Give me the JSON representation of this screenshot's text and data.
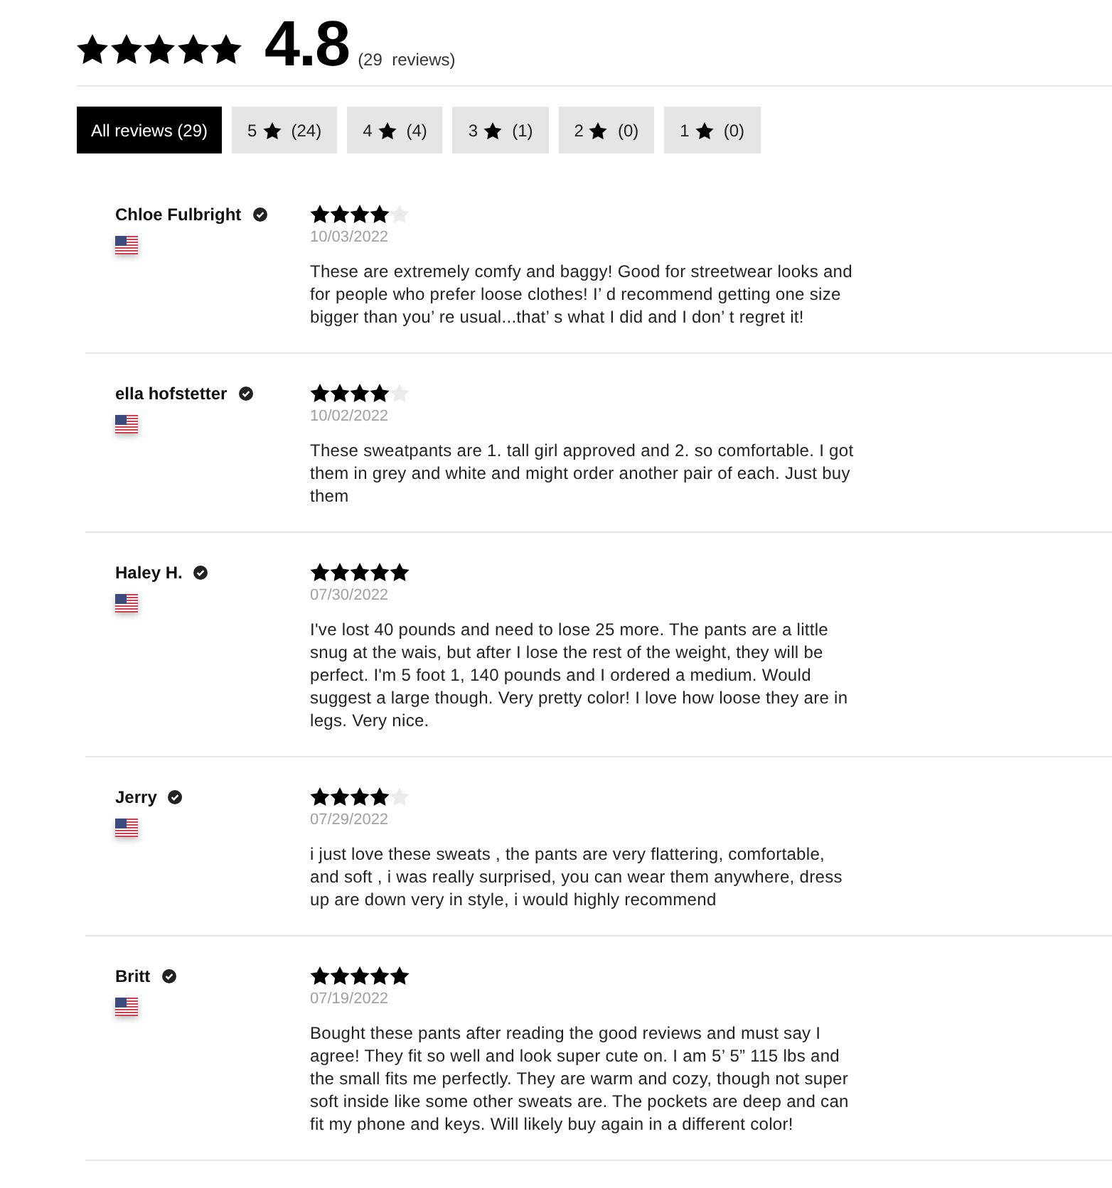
{
  "summary": {
    "stars": 5,
    "rating": "4.8",
    "count": "(29  reviews)"
  },
  "filters": [
    {
      "kind": "all",
      "label": "All reviews (29)",
      "selected": true
    },
    {
      "kind": "rating",
      "label": "5",
      "count": "(24)",
      "selected": false
    },
    {
      "kind": "rating",
      "label": "4",
      "count": "(4)",
      "selected": false
    },
    {
      "kind": "rating",
      "label": "3",
      "count": "(1)",
      "selected": false
    },
    {
      "kind": "rating",
      "label": "2",
      "count": "(0)",
      "selected": false
    },
    {
      "kind": "rating",
      "label": "1",
      "count": "(0)",
      "selected": false
    }
  ],
  "reviews": [
    {
      "name": "Chloe Fulbright",
      "verified": true,
      "stars": 4,
      "date": "10/03/2022",
      "text": "These are extremely comfy and baggy! Good for streetwear looks and for people who prefer loose clothes! I’ d recommend getting one size bigger than you’ re usual...that’ s what I did and I don’ t regret it!"
    },
    {
      "name": "ella hofstetter",
      "verified": true,
      "stars": 4,
      "date": "10/02/2022",
      "text": "These sweatpants are 1. tall girl approved and 2. so comfortable. I got them in grey and white and might order another pair of each. Just buy them"
    },
    {
      "name": "Haley H.",
      "verified": true,
      "stars": 5,
      "date": "07/30/2022",
      "text": "I've lost 40 pounds and need to lose 25 more. The pants are a little snug at the wais, but after I lose the rest of the weight, they will be perfect. I'm 5 foot 1, 140 pounds and I ordered a medium. Would suggest a large though. Very pretty color! I love how loose they are in legs. Very nice."
    },
    {
      "name": "Jerry",
      "verified": true,
      "stars": 4,
      "date": "07/29/2022",
      "text": "i just love these sweats , the pants are very flattering, comfortable, and soft , i was really surprised, you can wear them anywhere, dress up are down very in style, i would highly recommend"
    },
    {
      "name": "Britt",
      "verified": true,
      "stars": 5,
      "date": "07/19/2022",
      "text": "Bought these pants after reading the good reviews and must say I agree! They fit so well and look super cute on. I am 5’ 5” 115 lbs and the small fits me perfectly. They are warm and cozy, though not super soft inside like some other sweats are. The pockets are deep and can fit my phone and keys. Will likely buy again in a different color!"
    }
  ]
}
